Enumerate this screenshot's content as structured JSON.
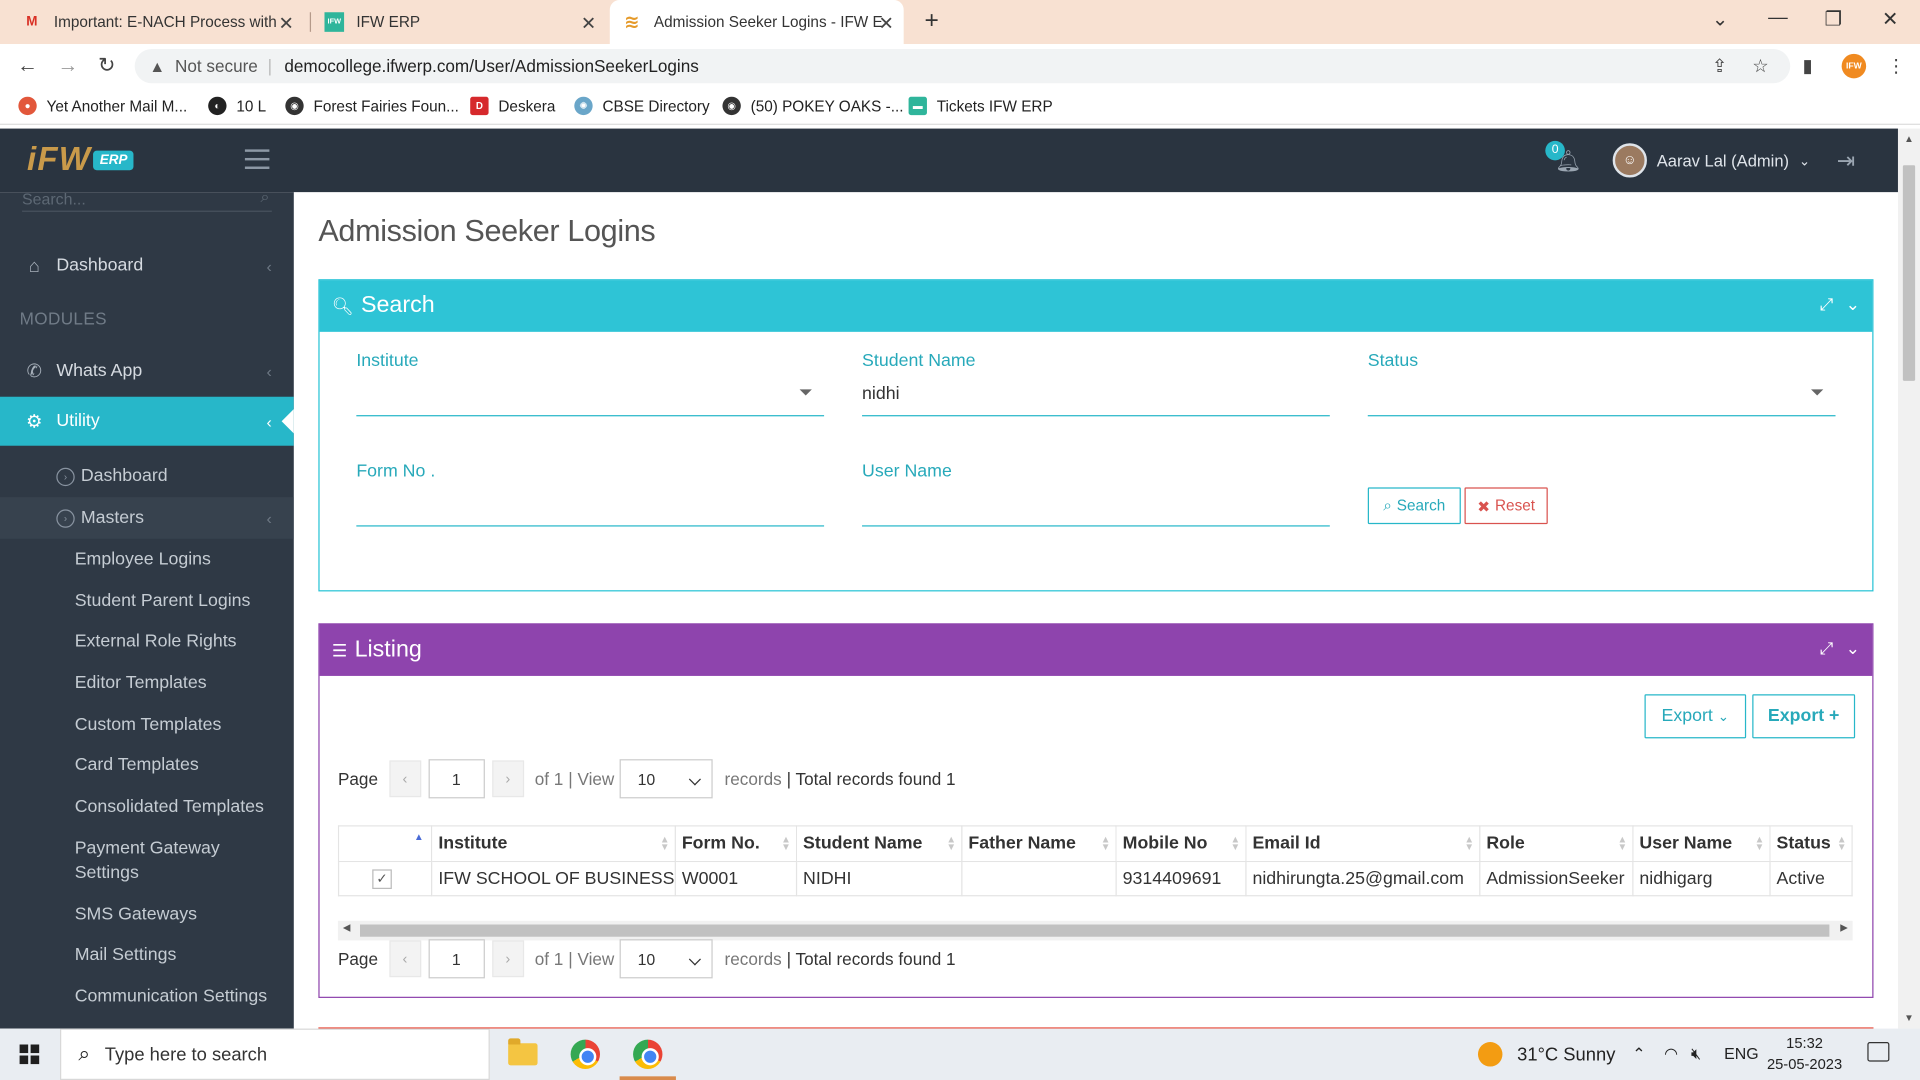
{
  "browser": {
    "tabs": [
      {
        "title": "Important: E-NACH Process with",
        "icon": "gmail-icon"
      },
      {
        "title": "IFW ERP",
        "icon": "ifw-favicon"
      },
      {
        "title": "Admission Seeker Logins - IFW E",
        "icon": "ifw-swirl-favicon",
        "active": true
      }
    ],
    "not_secure": "Not secure",
    "url": "democollege.ifwerp.com/User/AdmissionSeekerLogins",
    "bookmarks": [
      {
        "label": "Yet Another Mail M...",
        "color": "#e2573b"
      },
      {
        "label": "10 L",
        "color": "#222222"
      },
      {
        "label": "Forest Fairies Foun...",
        "color": "#333333"
      },
      {
        "label": "Deskera",
        "color": "#d6292c"
      },
      {
        "label": "CBSE Directory",
        "color": "#6aa6c9"
      },
      {
        "label": "(50) POKEY OAKS -...",
        "color": "#333333"
      },
      {
        "label": "Tickets IFW ERP",
        "color": "#2fb59b"
      }
    ]
  },
  "header": {
    "logo_text": "iFW",
    "logo_badge": "ERP",
    "notification_count": "0",
    "user_name": "Aarav Lal (Admin)"
  },
  "sidebar": {
    "search_placeholder": "Search...",
    "dashboard": "Dashboard",
    "modules_heading": "MODULES",
    "whatsapp": "Whats App",
    "utility": "Utility",
    "sub_dashboard": "Dashboard",
    "masters": "Masters",
    "leaves": [
      "Employee Logins",
      "Student Parent Logins",
      "External Role Rights",
      "Editor Templates",
      "Custom Templates",
      "Card Templates",
      "Consolidated Templates",
      "Payment Gateway Settings",
      "SMS Gateways",
      "Mail Settings",
      "Communication Settings"
    ]
  },
  "page": {
    "title": "Admission Seeker Logins"
  },
  "search_panel": {
    "title": "Search",
    "institute_label": "Institute",
    "institute_value": "",
    "student_name_label": "Student Name",
    "student_name_value": "nidhi",
    "status_label": "Status",
    "status_value": "",
    "form_no_label": "Form No .",
    "form_no_value": "",
    "user_name_label": "User Name",
    "user_name_value": "",
    "search_btn": "Search",
    "reset_btn": "Reset"
  },
  "listing_panel": {
    "title": "Listing",
    "export1": "Export",
    "export2": "Export",
    "pager": {
      "page_label": "Page",
      "page_value": "1",
      "of_text": "of 1",
      "view_text": "| View",
      "view_value": "10",
      "records_text": "records",
      "total_text": "| Total records found 1"
    },
    "columns": [
      "Institute",
      "Form No.",
      "Student Name",
      "Father Name",
      "Mobile No",
      "Email Id",
      "Role",
      "User Name",
      "Status"
    ],
    "rows": [
      {
        "institute": "IFW SCHOOL OF BUSINESS",
        "form_no": "W0001",
        "student_name": "NIDHI",
        "father_name": "",
        "mobile_no": "9314409691",
        "email": "nidhirungta.25@gmail.com",
        "role": "AdmissionSeeker",
        "user_name": "nidhigarg",
        "status": "Active"
      }
    ]
  },
  "taskbar": {
    "search_placeholder": "Type here to search",
    "weather": "31°C  Sunny",
    "lang": "ENG",
    "time": "15:32",
    "date": "25-05-2023"
  }
}
